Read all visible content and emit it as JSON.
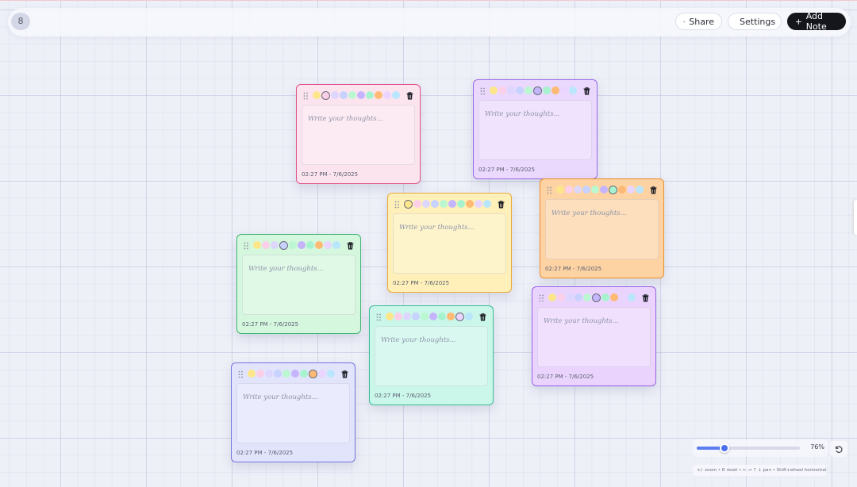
{
  "header": {
    "note_count": "8",
    "share_label": "Share",
    "settings_label": "Settings",
    "add_note_label": "Add Note"
  },
  "palette": [
    "#fde68a",
    "#fbcfe8",
    "#ddd6fe",
    "#c7d2fe",
    "#bbf7d0",
    "#c4b5fd",
    "#a7f3d0",
    "#fdba74",
    "#e9d5ff",
    "#bae6fd"
  ],
  "note_defaults": {
    "placeholder": "Write your thoughts...",
    "timestamp": "02:27 PM - 7/6/2025"
  },
  "notes": [
    {
      "id": "pink",
      "bg": "#fce4ef",
      "border": "#e0508a",
      "selected_swatch": 1,
      "placeholder": "Write your thoughts...",
      "timestamp": "02:27 PM - 7/6/2025"
    },
    {
      "id": "purple-top",
      "bg": "#ead8fd",
      "border": "#9a6ae6",
      "selected_swatch": 5,
      "placeholder": "Write your thoughts...",
      "timestamp": "02:27 PM - 7/6/2025"
    },
    {
      "id": "yellow",
      "bg": "#fef0b8",
      "border": "#ecaa3a",
      "selected_swatch": 0,
      "placeholder": "Write your thoughts...",
      "timestamp": "02:27 PM - 7/6/2025"
    },
    {
      "id": "orange",
      "bg": "#fdd3a4",
      "border": "#ee8e28",
      "selected_swatch": 6,
      "placeholder": "Write your thoughts...",
      "timestamp": "02:27 PM - 7/6/2025"
    },
    {
      "id": "green",
      "bg": "#d4f7de",
      "border": "#42b574",
      "selected_swatch": 3,
      "placeholder": "Write your thoughts...",
      "timestamp": "02:27 PM - 7/6/2025"
    },
    {
      "id": "mint",
      "bg": "#cbf7ea",
      "border": "#36bc94",
      "selected_swatch": 8,
      "placeholder": "Write your thoughts...",
      "timestamp": "02:27 PM - 7/6/2025"
    },
    {
      "id": "purple-right",
      "bg": "#ead4fd",
      "border": "#9a62e8",
      "selected_swatch": 5,
      "placeholder": "Write your thoughts...",
      "timestamp": "02:27 PM - 7/6/2025"
    },
    {
      "id": "indigo",
      "bg": "#e2e4fb",
      "border": "#7474dc",
      "selected_swatch": 7,
      "placeholder": "Write your thoughts...",
      "timestamp": "02:27 PM - 7/6/2025"
    }
  ],
  "zoom": {
    "label": "76%",
    "level": 0.27
  },
  "help_text": "+/- zoom • R reset • ← → ↑ ↓ pan • Shift+wheel horizontal pan",
  "icons": {
    "share": "share-icon",
    "settings": "gear-icon",
    "add": "plus-icon",
    "grip": "drag-handle-icon",
    "trash": "trash-icon",
    "reset": "rotate-ccw-icon"
  }
}
